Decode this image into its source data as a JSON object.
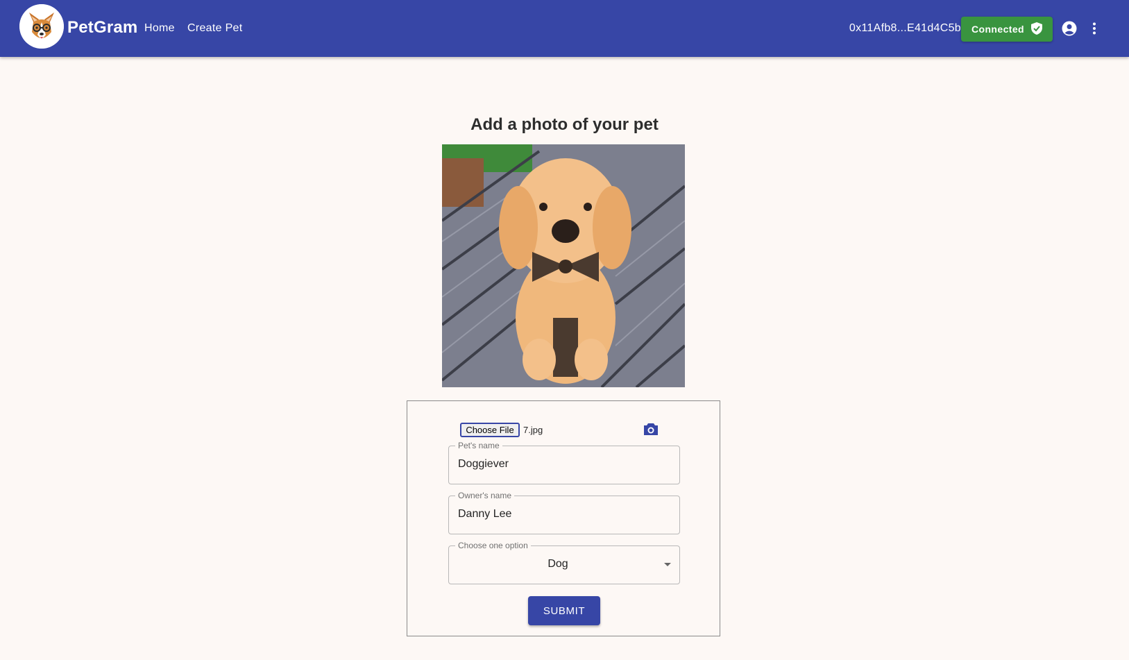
{
  "header": {
    "brand": "PetGram",
    "nav": [
      "Home",
      "Create Pet"
    ],
    "wallet_address": "0x11Afb8...E41d4C5b",
    "status_label": "Connected"
  },
  "main": {
    "title": "Add a photo of your pet",
    "file": {
      "button_label": "Choose File",
      "file_name": "7.jpg"
    },
    "fields": {
      "pet_name": {
        "label": "Pet's name",
        "value": "Doggiever"
      },
      "owner_name": {
        "label": "Owner's name",
        "value": "Danny Lee"
      },
      "pet_type": {
        "label": "Choose one option",
        "value": "Dog"
      }
    },
    "submit_label": "SUBMIT"
  },
  "colors": {
    "primary": "#3746a6",
    "success": "#39943f",
    "background": "#fdf8f5"
  },
  "icons": [
    "corgi-logo",
    "shield-check-icon",
    "account-circle-icon",
    "more-vert-icon",
    "camera-icon",
    "dropdown-arrow-icon"
  ]
}
